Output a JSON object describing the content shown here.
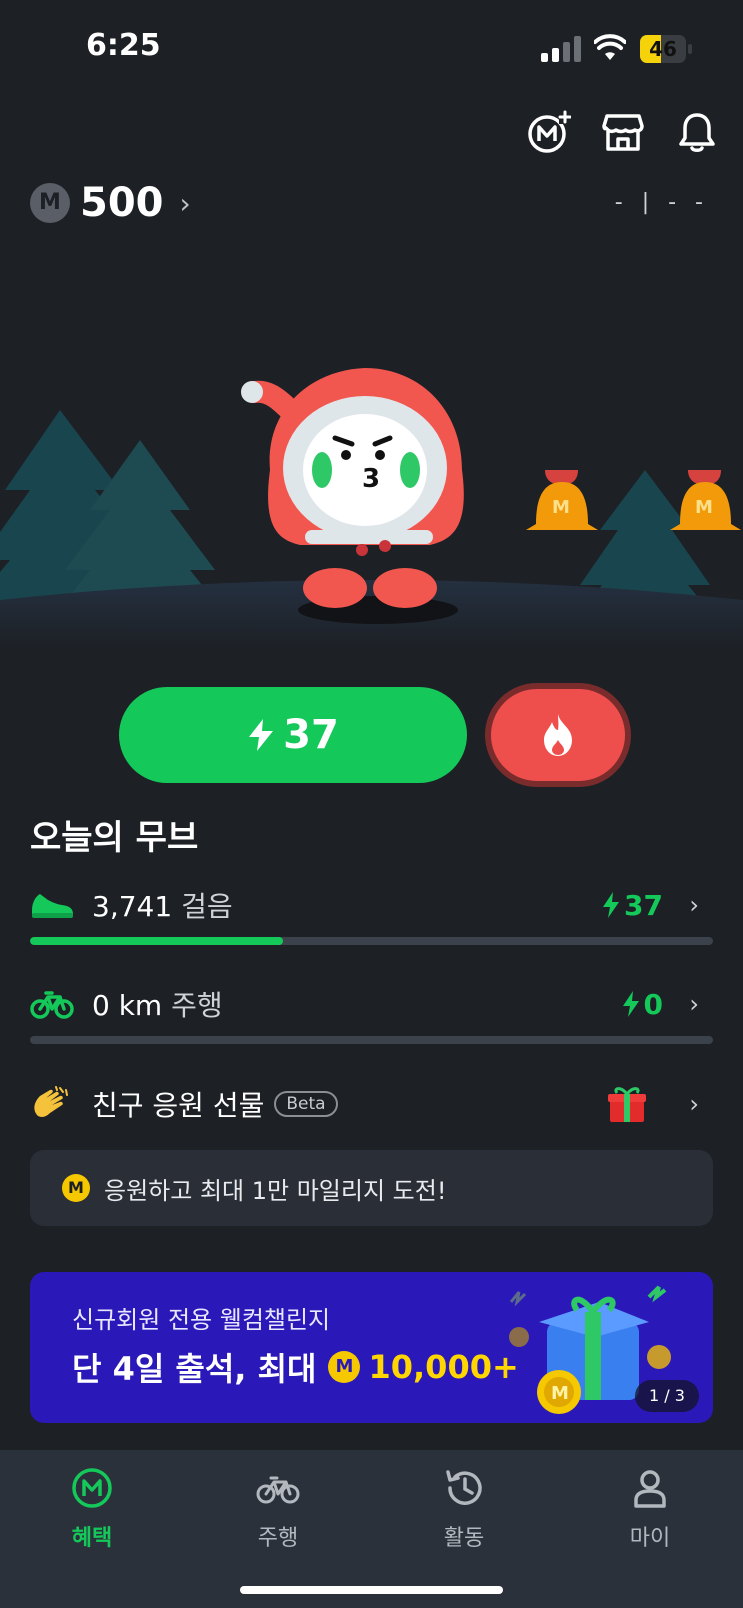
{
  "status_bar": {
    "time": "6:25",
    "battery": "46",
    "battery_level": 0.46
  },
  "header": {
    "icons": [
      "mileage-add-icon",
      "store-icon",
      "bell-icon"
    ],
    "mileage_symbol": "M",
    "mileage_value": "500",
    "weather_placeholder": "- | - -"
  },
  "scene": {
    "bell_badge": "M"
  },
  "actions": {
    "energy_value": "37"
  },
  "today": {
    "title": "오늘의 무브",
    "steps": {
      "count": "3,741",
      "unit": "걸음",
      "reward": "37",
      "progress": 0.37
    },
    "ride": {
      "distance": "0 km",
      "unit": "주행",
      "reward": "0",
      "progress": 0
    },
    "gift": {
      "label": "친구 응원 선물",
      "badge": "Beta"
    }
  },
  "notice": {
    "coin": "M",
    "text": "응원하고 최대 1만 마일리지 도전!"
  },
  "banner": {
    "subtitle": "신규회원 전용 웰컴챌린지",
    "title": "단 4일 출석, 최대",
    "coin": "M",
    "amount": "10,000+",
    "page": "1 / 3",
    "colors": {
      "background": "#2a18b8",
      "amount": "#ffd600"
    }
  },
  "tabs": [
    {
      "label": "혜택",
      "icon": "mileage-icon",
      "active": true
    },
    {
      "label": "주행",
      "icon": "bicycle-icon",
      "active": false
    },
    {
      "label": "활동",
      "icon": "history-icon",
      "active": false
    },
    {
      "label": "마이",
      "icon": "person-icon",
      "active": false
    }
  ],
  "colors": {
    "background": "#1d2025",
    "accent": "#14c85a",
    "fire": "#ef4f4c"
  }
}
